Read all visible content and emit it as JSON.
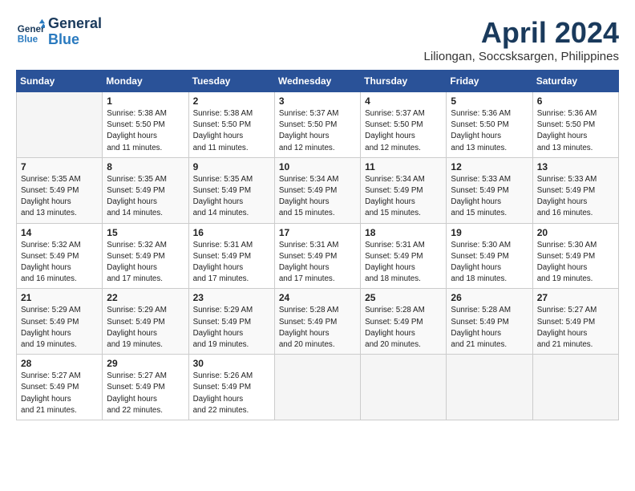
{
  "header": {
    "logo_line1": "General",
    "logo_line2": "Blue",
    "month": "April 2024",
    "location": "Liliongan, Soccsksargen, Philippines"
  },
  "weekdays": [
    "Sunday",
    "Monday",
    "Tuesday",
    "Wednesday",
    "Thursday",
    "Friday",
    "Saturday"
  ],
  "weeks": [
    [
      {
        "day": "",
        "empty": true
      },
      {
        "day": "1",
        "rise": "5:38 AM",
        "set": "5:50 PM",
        "daylight": "12 hours and 11 minutes."
      },
      {
        "day": "2",
        "rise": "5:38 AM",
        "set": "5:50 PM",
        "daylight": "12 hours and 11 minutes."
      },
      {
        "day": "3",
        "rise": "5:37 AM",
        "set": "5:50 PM",
        "daylight": "12 hours and 12 minutes."
      },
      {
        "day": "4",
        "rise": "5:37 AM",
        "set": "5:50 PM",
        "daylight": "12 hours and 12 minutes."
      },
      {
        "day": "5",
        "rise": "5:36 AM",
        "set": "5:50 PM",
        "daylight": "12 hours and 13 minutes."
      },
      {
        "day": "6",
        "rise": "5:36 AM",
        "set": "5:50 PM",
        "daylight": "12 hours and 13 minutes."
      }
    ],
    [
      {
        "day": "7",
        "rise": "5:35 AM",
        "set": "5:49 PM",
        "daylight": "12 hours and 13 minutes."
      },
      {
        "day": "8",
        "rise": "5:35 AM",
        "set": "5:49 PM",
        "daylight": "12 hours and 14 minutes."
      },
      {
        "day": "9",
        "rise": "5:35 AM",
        "set": "5:49 PM",
        "daylight": "12 hours and 14 minutes."
      },
      {
        "day": "10",
        "rise": "5:34 AM",
        "set": "5:49 PM",
        "daylight": "12 hours and 15 minutes."
      },
      {
        "day": "11",
        "rise": "5:34 AM",
        "set": "5:49 PM",
        "daylight": "12 hours and 15 minutes."
      },
      {
        "day": "12",
        "rise": "5:33 AM",
        "set": "5:49 PM",
        "daylight": "12 hours and 15 minutes."
      },
      {
        "day": "13",
        "rise": "5:33 AM",
        "set": "5:49 PM",
        "daylight": "12 hours and 16 minutes."
      }
    ],
    [
      {
        "day": "14",
        "rise": "5:32 AM",
        "set": "5:49 PM",
        "daylight": "12 hours and 16 minutes."
      },
      {
        "day": "15",
        "rise": "5:32 AM",
        "set": "5:49 PM",
        "daylight": "12 hours and 17 minutes."
      },
      {
        "day": "16",
        "rise": "5:31 AM",
        "set": "5:49 PM",
        "daylight": "12 hours and 17 minutes."
      },
      {
        "day": "17",
        "rise": "5:31 AM",
        "set": "5:49 PM",
        "daylight": "12 hours and 17 minutes."
      },
      {
        "day": "18",
        "rise": "5:31 AM",
        "set": "5:49 PM",
        "daylight": "12 hours and 18 minutes."
      },
      {
        "day": "19",
        "rise": "5:30 AM",
        "set": "5:49 PM",
        "daylight": "12 hours and 18 minutes."
      },
      {
        "day": "20",
        "rise": "5:30 AM",
        "set": "5:49 PM",
        "daylight": "12 hours and 19 minutes."
      }
    ],
    [
      {
        "day": "21",
        "rise": "5:29 AM",
        "set": "5:49 PM",
        "daylight": "12 hours and 19 minutes."
      },
      {
        "day": "22",
        "rise": "5:29 AM",
        "set": "5:49 PM",
        "daylight": "12 hours and 19 minutes."
      },
      {
        "day": "23",
        "rise": "5:29 AM",
        "set": "5:49 PM",
        "daylight": "12 hours and 19 minutes."
      },
      {
        "day": "24",
        "rise": "5:28 AM",
        "set": "5:49 PM",
        "daylight": "12 hours and 20 minutes."
      },
      {
        "day": "25",
        "rise": "5:28 AM",
        "set": "5:49 PM",
        "daylight": "12 hours and 20 minutes."
      },
      {
        "day": "26",
        "rise": "5:28 AM",
        "set": "5:49 PM",
        "daylight": "12 hours and 21 minutes."
      },
      {
        "day": "27",
        "rise": "5:27 AM",
        "set": "5:49 PM",
        "daylight": "12 hours and 21 minutes."
      }
    ],
    [
      {
        "day": "28",
        "rise": "5:27 AM",
        "set": "5:49 PM",
        "daylight": "12 hours and 21 minutes."
      },
      {
        "day": "29",
        "rise": "5:27 AM",
        "set": "5:49 PM",
        "daylight": "12 hours and 22 minutes."
      },
      {
        "day": "30",
        "rise": "5:26 AM",
        "set": "5:49 PM",
        "daylight": "12 hours and 22 minutes."
      },
      {
        "day": "",
        "empty": true
      },
      {
        "day": "",
        "empty": true
      },
      {
        "day": "",
        "empty": true
      },
      {
        "day": "",
        "empty": true
      }
    ]
  ],
  "labels": {
    "sunrise": "Sunrise:",
    "sunset": "Sunset:",
    "daylight": "Daylight hours"
  }
}
